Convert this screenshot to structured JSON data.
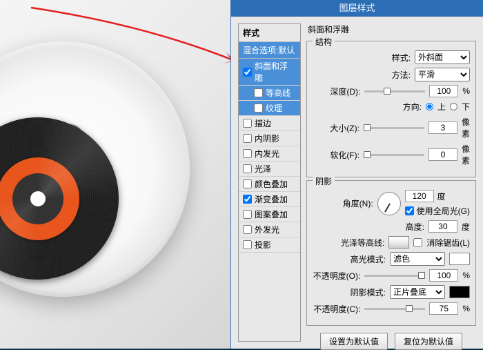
{
  "dialog": {
    "title": "图层样式",
    "styles_header": "样式",
    "styles_subheader": "混合选项:默认",
    "styles": [
      {
        "label": "斜面和浮雕",
        "checked": true,
        "selected": true
      },
      {
        "label": "等高线",
        "checked": false,
        "selected": true,
        "sub": true
      },
      {
        "label": "纹理",
        "checked": false,
        "selected": true,
        "sub": true
      },
      {
        "label": "描边",
        "checked": false
      },
      {
        "label": "内阴影",
        "checked": false
      },
      {
        "label": "内发光",
        "checked": false
      },
      {
        "label": "光泽",
        "checked": false
      },
      {
        "label": "颜色叠加",
        "checked": false
      },
      {
        "label": "渐变叠加",
        "checked": true
      },
      {
        "label": "图案叠加",
        "checked": false
      },
      {
        "label": "外发光",
        "checked": false
      },
      {
        "label": "投影",
        "checked": false
      }
    ],
    "bevel": {
      "title": "斜面和浮雕",
      "structure_title": "结构",
      "style_label": "样式:",
      "style_value": "外斜面",
      "technique_label": "方法:",
      "technique_value": "平滑",
      "depth_label": "深度(D):",
      "depth": "100",
      "depth_unit": "%",
      "direction_label": "方向:",
      "direction_up": "上",
      "direction_down": "下",
      "size_label": "大小(Z):",
      "size": "3",
      "size_unit": "像素",
      "soften_label": "软化(F):",
      "soften": "0",
      "soften_unit": "像素"
    },
    "shading": {
      "title": "阴影",
      "angle_label": "角度(N):",
      "angle": "120",
      "angle_unit": "度",
      "global_label": "使用全局光(G)",
      "altitude_label": "高度:",
      "altitude": "30",
      "altitude_unit": "度",
      "gloss_label": "光泽等高线:",
      "antialias_label": "消除锯齿(L)",
      "highlight_mode_label": "高光模式:",
      "highlight_mode": "滤色",
      "highlight_opacity_label": "不透明度(O):",
      "highlight_opacity": "100",
      "highlight_opacity_unit": "%",
      "shadow_mode_label": "阴影模式:",
      "shadow_mode": "正片叠底",
      "shadow_opacity_label": "不透明度(C):",
      "shadow_opacity": "75",
      "shadow_opacity_unit": "%"
    },
    "footer": {
      "make_default": "设置为默认值",
      "reset_default": "复位为默认值"
    }
  }
}
